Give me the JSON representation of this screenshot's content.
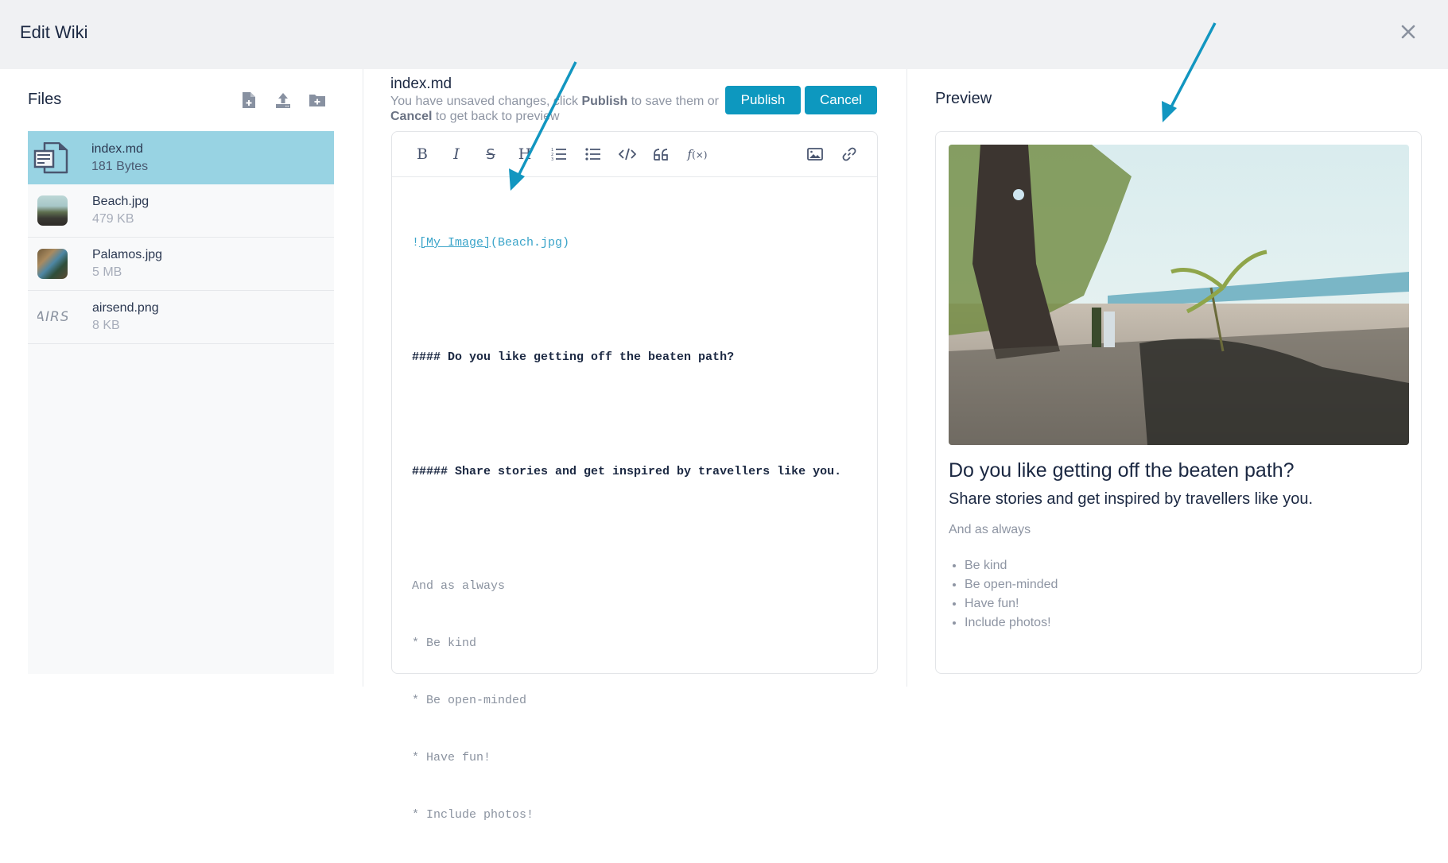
{
  "header": {
    "title": "Edit Wiki",
    "close_icon": "close-icon"
  },
  "files": {
    "heading": "Files",
    "actions": [
      {
        "name": "new-file",
        "icon": "file-plus-icon"
      },
      {
        "name": "upload",
        "icon": "upload-icon"
      },
      {
        "name": "new-folder",
        "icon": "folder-plus-icon"
      }
    ],
    "items": [
      {
        "name": "index.md",
        "size": "181 Bytes",
        "type": "document",
        "selected": true
      },
      {
        "name": "Beach.jpg",
        "size": "479 KB",
        "type": "image"
      },
      {
        "name": "Palamos.jpg",
        "size": "5 MB",
        "type": "image"
      },
      {
        "name": "airsend.png",
        "size": "8 KB",
        "type": "image",
        "thumb_text": "AIRS"
      }
    ]
  },
  "editor": {
    "filename": "index.md",
    "notice": {
      "part1": "You have unsaved changes, click ",
      "publish_word": "Publish",
      "part2": " to save them or ",
      "cancel_word": "Cancel",
      "part3": " to get back to preview"
    },
    "publish_label": "Publish",
    "cancel_label": "Cancel",
    "toolbar": [
      {
        "name": "bold",
        "glyph": "B"
      },
      {
        "name": "italic",
        "glyph": "I"
      },
      {
        "name": "strikethrough",
        "glyph": "S"
      },
      {
        "name": "heading",
        "glyph": "H"
      },
      {
        "name": "ordered-list",
        "glyph": "ol"
      },
      {
        "name": "unordered-list",
        "glyph": "ul"
      },
      {
        "name": "code",
        "glyph": "</>"
      },
      {
        "name": "quote",
        "glyph": "66"
      },
      {
        "name": "formula",
        "glyph": "f(x)"
      },
      {
        "name": "image",
        "glyph": "img"
      },
      {
        "name": "link",
        "glyph": "link"
      }
    ],
    "content": {
      "image_bang": "!",
      "image_alt": "[My Image]",
      "image_src": "(Beach.jpg)",
      "h4": "#### Do you like getting off the beaten path?",
      "h5": "##### Share stories and get inspired by travellers like you.",
      "p": "And as always",
      "bullets": [
        "* Be kind",
        "* Be open-minded",
        "* Have fun!",
        "* Include photos!"
      ]
    }
  },
  "preview": {
    "heading": "Preview",
    "image_alt": "My Image",
    "h4": "Do you like getting off the beaten path?",
    "h5": "Share stories and get inspired by travellers like you.",
    "p": "And as always",
    "bullets": [
      "Be kind",
      "Be open-minded",
      "Have fun!",
      "Include photos!"
    ]
  },
  "colors": {
    "accent": "#0d98bf",
    "selected_row": "#98d3e3",
    "header_bg": "#f0f1f3",
    "annotation_arrow": "#1296c0"
  }
}
